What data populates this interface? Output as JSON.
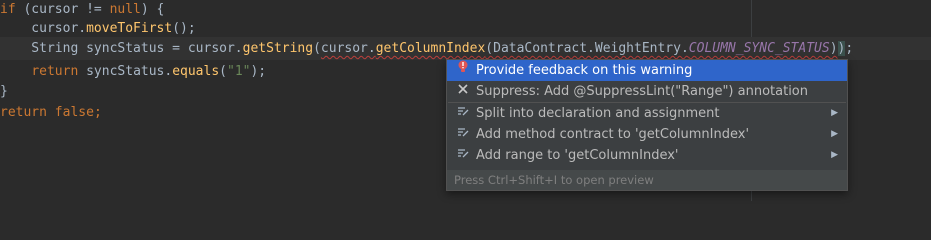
{
  "code": {
    "l1_if": "if",
    "l1_cond": " (cursor != ",
    "l1_null": "null",
    "l1_end": ") {",
    "l2_pre": "    cursor.",
    "l2_method": "moveToFirst",
    "l2_end": "();",
    "l3_decl": "    String syncStatus = cursor.",
    "l3_getString": "getString",
    "l3_open": "(",
    "l3_inner_obj": "cursor.",
    "l3_getColumnIndex": "getColumnIndex",
    "l3_arg": "(DataContract.WeightEntry.",
    "l3_const": "COLUMN_SYNC_STATUS",
    "l3_close_inner": ")",
    "l3_close_outer": ")",
    "l3_semi": ";",
    "l4_return": "return",
    "l4_mid": " syncStatus.",
    "l4_equals": "equals",
    "l4_open": "(",
    "l4_str": "\"1\"",
    "l4_end": ");",
    "l5_brace": "}",
    "l6_return": "return",
    "l6_false": "false",
    "l6_semi": ";"
  },
  "popup": {
    "items": [
      {
        "label": "Provide feedback on this warning",
        "icon": "lightbulb-alert-icon"
      },
      {
        "label": "Suppress: Add @SuppressLint(\"Range\") annotation",
        "icon": "close-icon"
      },
      {
        "label": "Split into declaration and assignment",
        "icon": "intention-icon"
      },
      {
        "label": "Add method contract to 'getColumnIndex'",
        "icon": "intention-icon"
      },
      {
        "label": "Add range to 'getColumnIndex'",
        "icon": "intention-icon"
      }
    ],
    "footer": "Press Ctrl+Shift+I to open preview"
  },
  "colors": {
    "background": "#2b2b2b",
    "keyword": "#cc7832",
    "method": "#ffc66d",
    "string": "#6a8759",
    "constant": "#9876aa",
    "selection": "#2f65ca"
  }
}
